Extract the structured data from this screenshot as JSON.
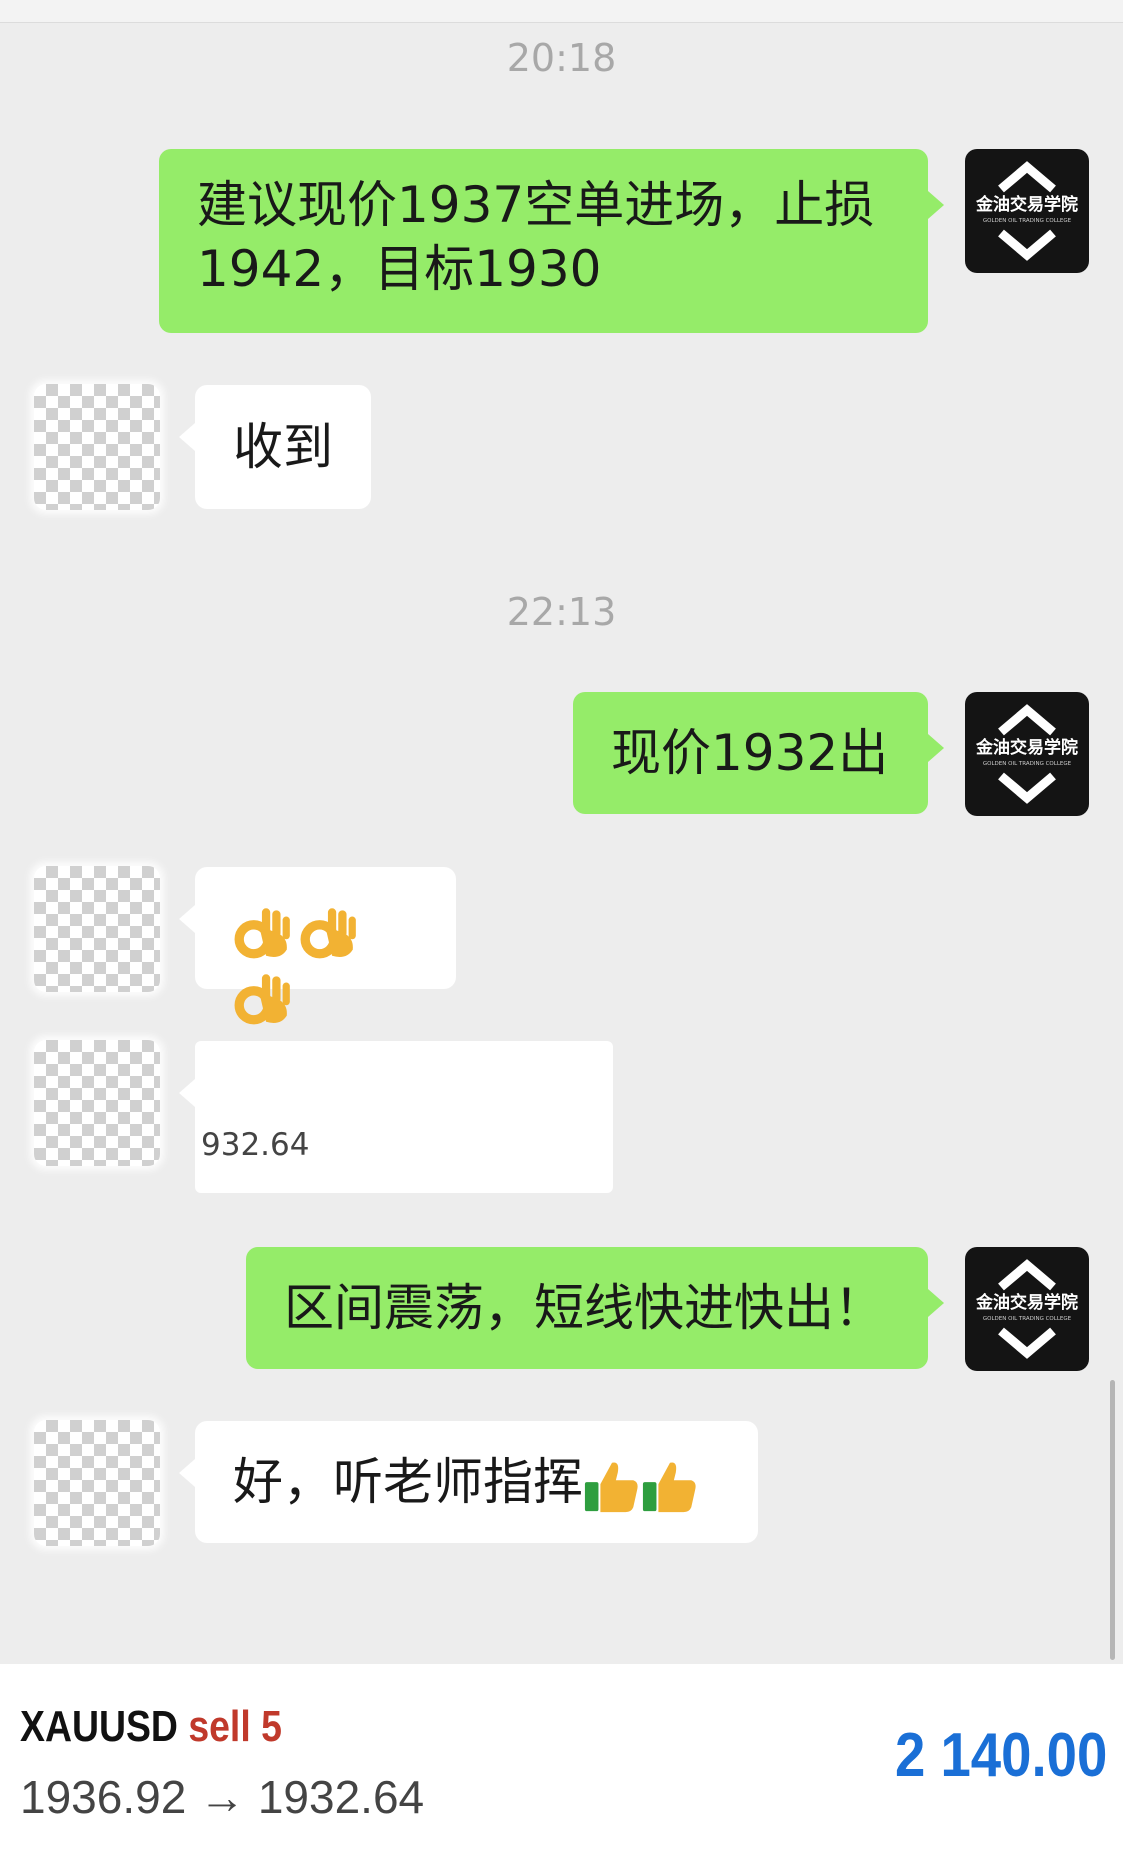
{
  "chat": {
    "timestamps": [
      "20:18",
      "22:13"
    ],
    "messages": [
      {
        "sender": "me",
        "text_line1": "建议现价1937空单进场，止损",
        "text_line2": "1942，目标1930"
      },
      {
        "sender": "other",
        "text": "收到"
      },
      {
        "sender": "me",
        "text": "现价1932出"
      },
      {
        "sender": "other",
        "emoji": "ok-hand-icon",
        "count": 3
      },
      {
        "sender": "other",
        "text": "932.64"
      },
      {
        "sender": "me",
        "text": "区间震荡，短线快进快出！"
      },
      {
        "sender": "other",
        "text": "好，听老师指挥",
        "emoji": "thumbs-up-icon",
        "count": 2
      }
    ],
    "my_avatar": {
      "line1": "金油交易学院",
      "line2": "GOLDEN OIL TRADING COLLEGE"
    }
  },
  "trade": {
    "symbol": "XAUUSD",
    "side": "sell 5",
    "open_price": "1936.92",
    "arrow": "→",
    "close_price": "1932.64",
    "profit": "2 140.00"
  },
  "colors": {
    "my_bubble": "#95ec69",
    "other_bubble": "#ffffff",
    "background": "#ededed",
    "sell": "#c0392b",
    "profit": "#1a6fd6"
  }
}
